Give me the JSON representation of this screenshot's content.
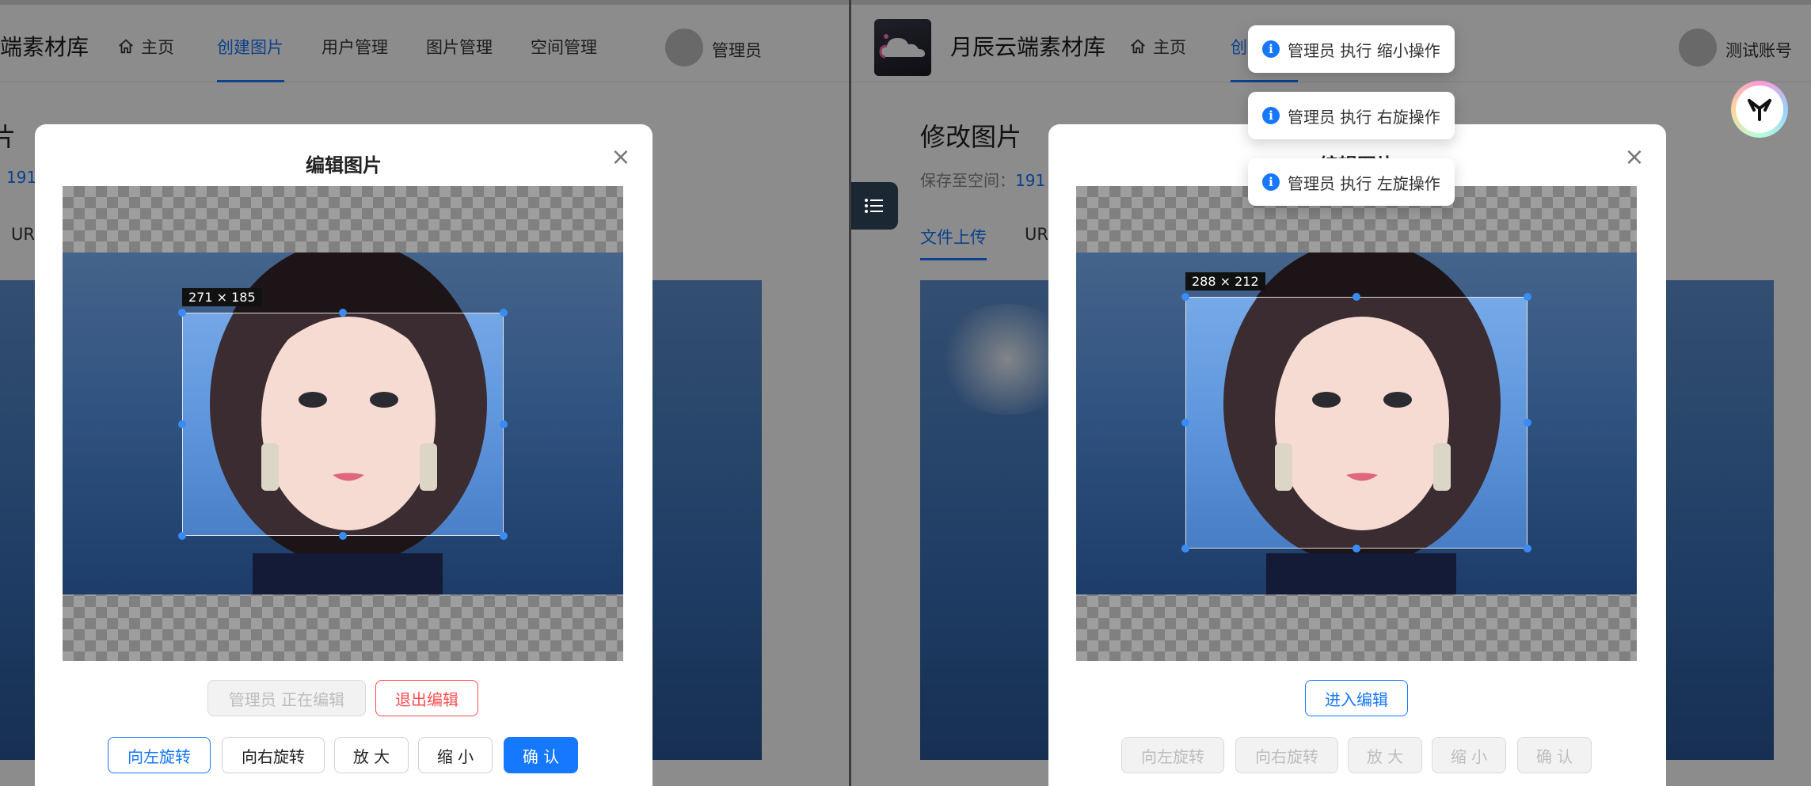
{
  "left": {
    "header": {
      "brand": "端素材库",
      "nav": [
        {
          "label": "主页",
          "icon": "home-icon"
        },
        {
          "label": "创建图片",
          "active": true
        },
        {
          "label": "用户管理"
        },
        {
          "label": "图片管理"
        },
        {
          "label": "空间管理"
        }
      ],
      "user": "管理员"
    },
    "page": {
      "title_fragment": "片",
      "save_fragment": "191",
      "tab_fragment": "UR"
    },
    "modal": {
      "title": "编辑图片",
      "crop_size": "271 × 185",
      "status_button": "管理员 正在编辑",
      "exit_button": "退出编辑",
      "actions": [
        "向左旋转",
        "向右旋转",
        "放 大",
        "缩 小",
        "确 认"
      ]
    }
  },
  "right": {
    "header": {
      "brand": "月辰云端素材库",
      "nav": [
        {
          "label": "主页",
          "icon": "home-icon"
        },
        {
          "label": "创",
          "active": true
        }
      ],
      "user": "测试账号"
    },
    "page": {
      "title": "修改图片",
      "save_prefix": "保存至空间：",
      "save_fragment": "191",
      "tabs": [
        "文件上传",
        "UR"
      ]
    },
    "modal": {
      "title_fragment": "编辑图片",
      "crop_size": "288 × 212",
      "enter_button": "进入编辑",
      "actions": [
        "向左旋转",
        "向右旋转",
        "放 大",
        "缩 小",
        "确 认"
      ]
    },
    "toasts": [
      "管理员 执行 缩小操作",
      "管理员 执行 右旋操作",
      "管理员 执行 左旋操作"
    ]
  },
  "colors": {
    "primary": "#1677ff",
    "danger": "#ff4d4f",
    "mask": "rgba(0,0,0,0.45)"
  }
}
